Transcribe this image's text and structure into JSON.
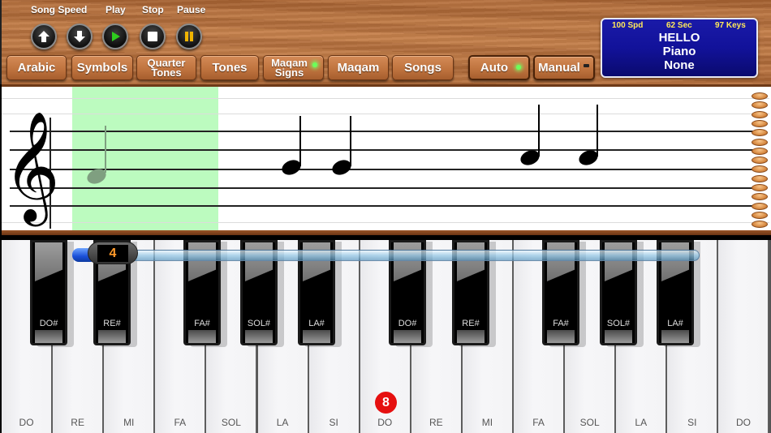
{
  "controls": {
    "labels": {
      "song_speed": "Song Speed",
      "play": "Play",
      "stop": "Stop",
      "pause": "Pause"
    },
    "buttons": [
      {
        "name": "speed-up-button",
        "icon": "arrow-up-icon"
      },
      {
        "name": "speed-down-button",
        "icon": "arrow-down-icon"
      },
      {
        "name": "play-button",
        "icon": "play-icon",
        "color": "#2ecc1e"
      },
      {
        "name": "stop-button",
        "icon": "stop-icon",
        "color": "#ffffff"
      },
      {
        "name": "pause-button",
        "icon": "pause-icon",
        "color": "#f0b400"
      }
    ]
  },
  "tabs": [
    {
      "label": "Arabic"
    },
    {
      "label": "Symbols"
    },
    {
      "label_line1": "Quarter",
      "label_line2": "Tones"
    },
    {
      "label": "Tones"
    },
    {
      "label_line1": "Maqam",
      "label_line2": "Signs",
      "led": "on"
    },
    {
      "label": "Maqam"
    },
    {
      "label": "Songs"
    }
  ],
  "mode_toggles": {
    "auto": {
      "label": "Auto",
      "led": "on"
    },
    "manual": {
      "label": "Manual",
      "led": "off"
    }
  },
  "info_panel": {
    "speed": "100 Spd",
    "time": "62 Sec",
    "keys": "97 Keys",
    "song": "HELLO",
    "instrument": "Piano",
    "maqam": "None"
  },
  "staff": {
    "clef": "𝄞",
    "notes": [
      {
        "type": "quarter",
        "state": "current",
        "pitch": "G"
      },
      {
        "type": "quarter",
        "state": "upcoming",
        "pitch": "A"
      },
      {
        "type": "quarter",
        "state": "upcoming",
        "pitch": "A"
      },
      {
        "type": "quarter",
        "state": "upcoming",
        "pitch": "B"
      },
      {
        "type": "quarter",
        "state": "upcoming",
        "pitch": "B"
      }
    ],
    "highlight_color": "#bcfbbf"
  },
  "keyboard": {
    "octave_slider_value": "4",
    "octave_marker": "8",
    "white_keys": [
      "DO",
      "RE",
      "MI",
      "FA",
      "SOL",
      "LA",
      "SI",
      "DO",
      "RE",
      "MI",
      "FA",
      "SOL",
      "LA",
      "SI",
      "DO"
    ],
    "black_keys": [
      "DO#",
      "RE#",
      "FA#",
      "SOL#",
      "LA#",
      "DO#",
      "RE#",
      "FA#",
      "SOL#",
      "LA#"
    ]
  }
}
